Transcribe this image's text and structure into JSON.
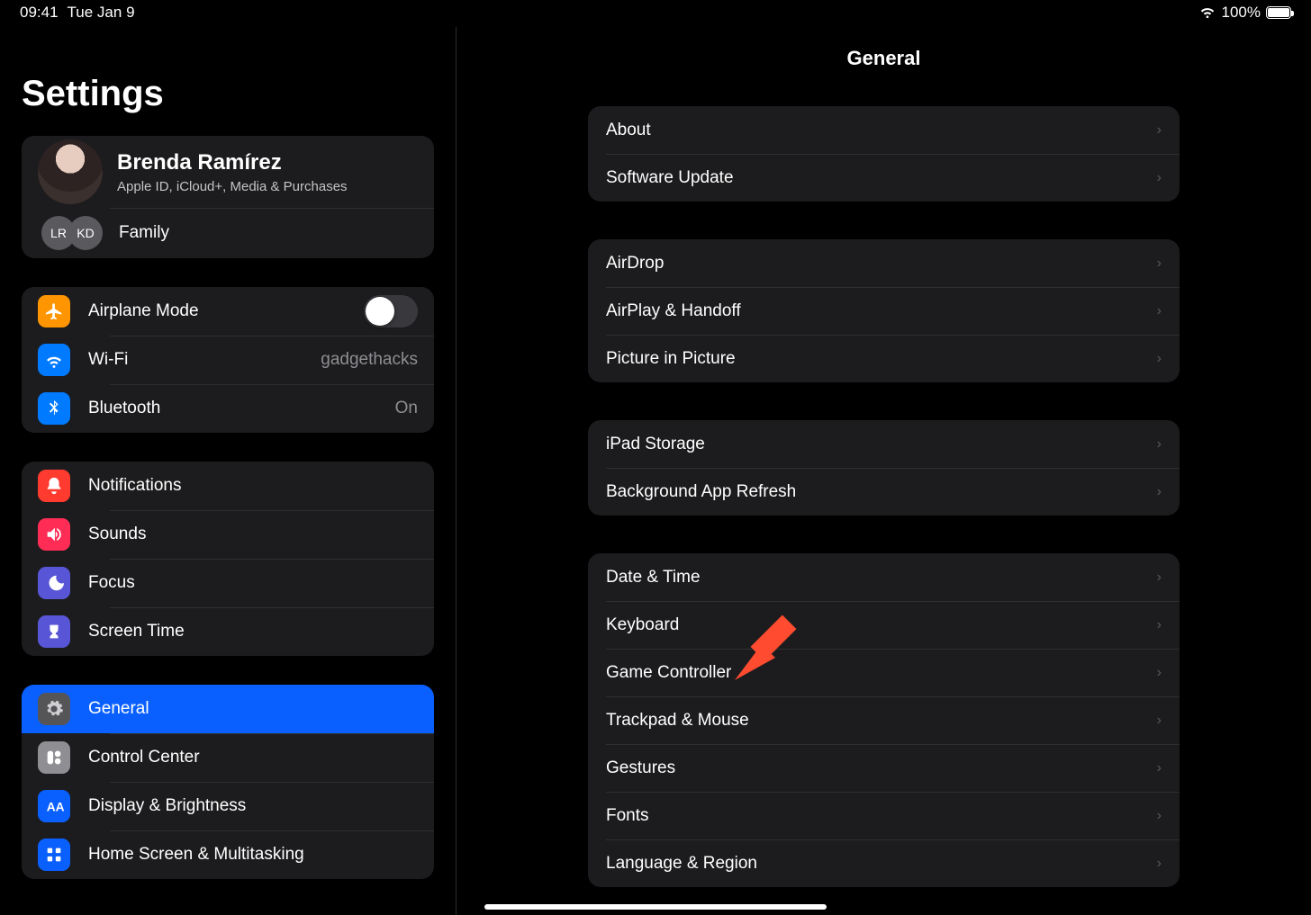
{
  "statusbar": {
    "time": "09:41",
    "date": "Tue Jan 9",
    "battery": "100%"
  },
  "sidebar": {
    "title": "Settings",
    "identity": {
      "name": "Brenda Ramírez",
      "subtitle": "Apple ID, iCloud+, Media & Purchases",
      "family_label": "Family",
      "family_members": [
        "LR",
        "KD"
      ]
    },
    "group_conn": {
      "airplane": "Airplane Mode",
      "wifi": "Wi-Fi",
      "wifi_value": "gadgethacks",
      "bluetooth": "Bluetooth",
      "bluetooth_value": "On"
    },
    "group_notif": {
      "notifications": "Notifications",
      "sounds": "Sounds",
      "focus": "Focus",
      "screentime": "Screen Time"
    },
    "group_gen": {
      "general": "General",
      "control": "Control Center",
      "display": "Display & Brightness",
      "home": "Home Screen & Multitasking"
    }
  },
  "detail": {
    "title": "General",
    "group1": {
      "about": "About",
      "software": "Software Update"
    },
    "group2": {
      "airdrop": "AirDrop",
      "airplay": "AirPlay & Handoff",
      "pip": "Picture in Picture"
    },
    "group3": {
      "storage": "iPad Storage",
      "refresh": "Background App Refresh"
    },
    "group4": {
      "date": "Date & Time",
      "keyboard": "Keyboard",
      "game": "Game Controller",
      "trackpad": "Trackpad & Mouse",
      "gestures": "Gestures",
      "fonts": "Fonts",
      "lang": "Language & Region"
    }
  }
}
